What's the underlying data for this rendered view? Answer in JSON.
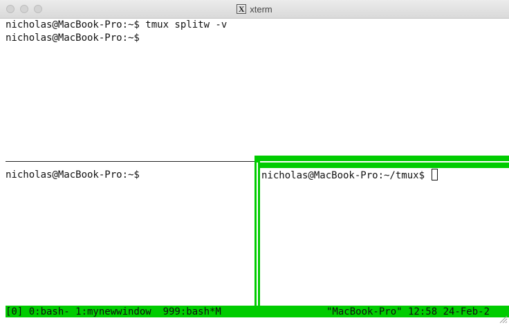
{
  "window": {
    "title": "xterm"
  },
  "panes": {
    "top": {
      "lines": [
        "nicholas@MacBook-Pro:~$ tmux splitw -v",
        "nicholas@MacBook-Pro:~$"
      ]
    },
    "bottom_left": {
      "lines": [
        "nicholas@MacBook-Pro:~$"
      ]
    },
    "bottom_right": {
      "prompt": "nicholas@MacBook-Pro:~/tmux$"
    }
  },
  "status_bar": {
    "left": "[0] 0:bash- 1:mynewwindow  999:bash*M",
    "right": "\"MacBook-Pro\" 12:58 24-Feb-2"
  },
  "colors": {
    "tmux_active": "#00cc00",
    "text": "#111111"
  }
}
